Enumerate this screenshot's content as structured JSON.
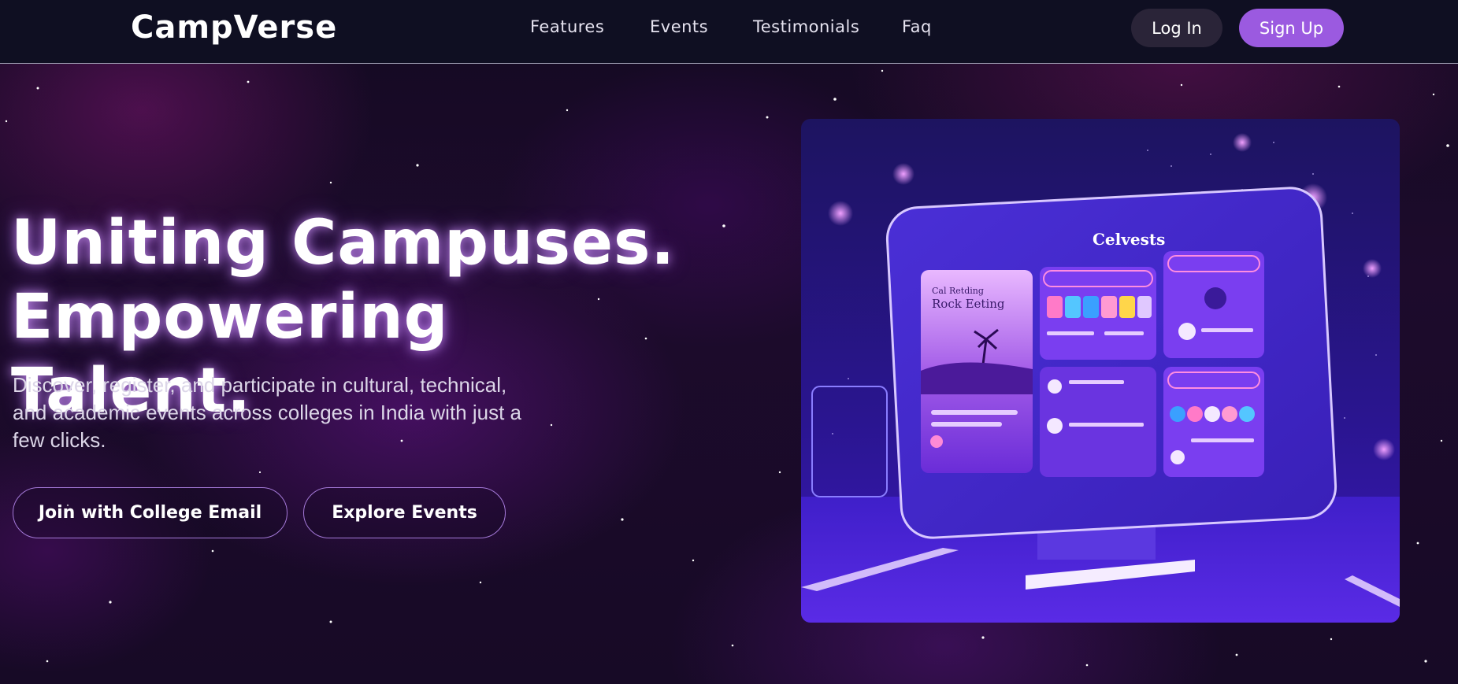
{
  "navbar": {
    "brand": "CampVerse",
    "links": [
      "Features",
      "Events",
      "Testimonials",
      "Faq"
    ],
    "login_label": "Log In",
    "signup_label": "Sign Up"
  },
  "hero": {
    "title_line1": "Uniting Campuses.",
    "title_line2": "Empowering Talent.",
    "description": "Discover, register, and participate in cultural, technical, and academic events across colleges in India with just a few clicks.",
    "primary_cta": "Join with College Email",
    "secondary_cta": "Explore Events",
    "image": {
      "screen_title": "Celvests",
      "card_title": "Rock Eeting",
      "card_kicker": "Cal Retding"
    }
  },
  "colors": {
    "accent": "#9b5ae0",
    "nav_bg": "#0f0f22",
    "cta_border": "#a479d8"
  }
}
